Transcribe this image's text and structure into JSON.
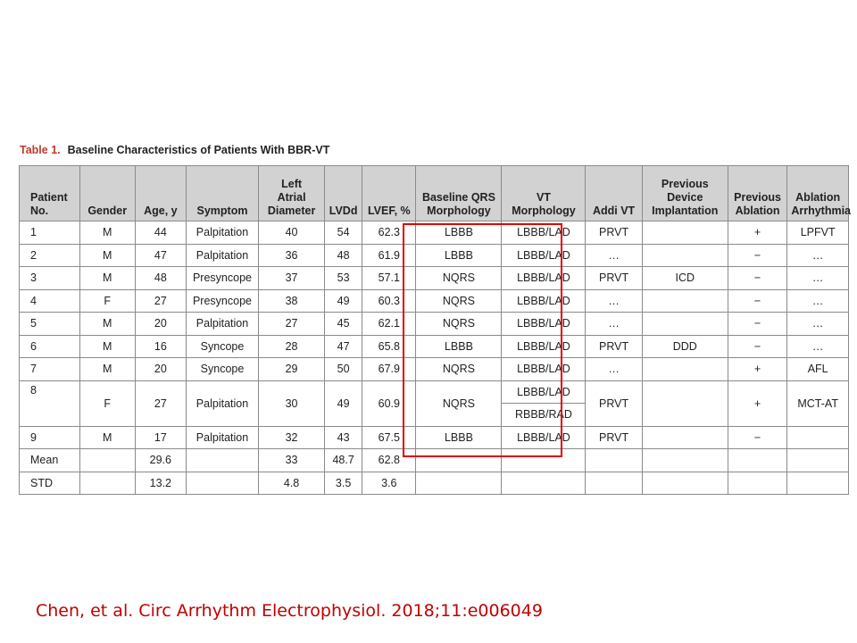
{
  "table": {
    "label": "Table 1.",
    "title": "Baseline Characteristics of Patients With BBR-VT",
    "headers": [
      "Patient\nNo.",
      "Gender",
      "Age, y",
      "Symptom",
      "Left\nAtrial\nDiameter",
      "LVDd",
      "LVEF, %",
      "Baseline QRS\nMorphology",
      "VT\nMorphology",
      "Addi VT",
      "Previous\nDevice\nImplantation",
      "Previous\nAblation",
      "Ablation\nArrhythmia"
    ],
    "rows": [
      [
        "1",
        "M",
        "44",
        "Palpitation",
        "40",
        "54",
        "62.3",
        "LBBB",
        "LBBB/LAD",
        "PRVT",
        "",
        "+",
        "LPFVT"
      ],
      [
        "2",
        "M",
        "47",
        "Palpitation",
        "36",
        "48",
        "61.9",
        "LBBB",
        "LBBB/LAD",
        "…",
        "",
        "−",
        "…"
      ],
      [
        "3",
        "M",
        "48",
        "Presyncope",
        "37",
        "53",
        "57.1",
        "NQRS",
        "LBBB/LAD",
        "PRVT",
        "ICD",
        "−",
        "…"
      ],
      [
        "4",
        "F",
        "27",
        "Presyncope",
        "38",
        "49",
        "60.3",
        "NQRS",
        "LBBB/LAD",
        "…",
        "",
        "−",
        "…"
      ],
      [
        "5",
        "M",
        "20",
        "Palpitation",
        "27",
        "45",
        "62.1",
        "NQRS",
        "LBBB/LAD",
        "…",
        "",
        "−",
        "…"
      ],
      [
        "6",
        "M",
        "16",
        "Syncope",
        "28",
        "47",
        "65.8",
        "LBBB",
        "LBBB/LAD",
        "PRVT",
        "DDD",
        "−",
        "…"
      ],
      [
        "7",
        "M",
        "20",
        "Syncope",
        "29",
        "50",
        "67.9",
        "NQRS",
        "LBBB/LAD",
        "…",
        "",
        "+",
        "AFL"
      ]
    ],
    "row8": {
      "no": "8",
      "gender": "F",
      "age": "27",
      "symptom": "Palpitation",
      "lad": "30",
      "lvdd": "49",
      "lvef": "60.9",
      "qrs": "NQRS",
      "vt1": "LBBB/LAD",
      "vt2": "RBBB/RAD",
      "addi": "PRVT",
      "device": "",
      "prev_ablation": "+",
      "ablation": "MCT-AT"
    },
    "row9": [
      "9",
      "M",
      "17",
      "Palpitation",
      "32",
      "43",
      "67.5",
      "LBBB",
      "LBBB/LAD",
      "PRVT",
      "",
      "−",
      ""
    ],
    "summary": [
      [
        "Mean",
        "",
        "29.6",
        "",
        "33",
        "48.7",
        "62.8",
        "",
        "",
        "",
        "",
        "",
        ""
      ],
      [
        "STD",
        "",
        "13.2",
        "",
        "4.8",
        "3.5",
        "3.6",
        "",
        "",
        "",
        "",
        "",
        ""
      ]
    ]
  },
  "highlight_color": "#e00000",
  "citation": "Chen, et al. Circ Arrhythm Electrophysiol. 2018;11:e006049",
  "colors": {
    "header_bg": "#d2d2d2",
    "label": "#c0392b",
    "citation": "#c00000"
  }
}
